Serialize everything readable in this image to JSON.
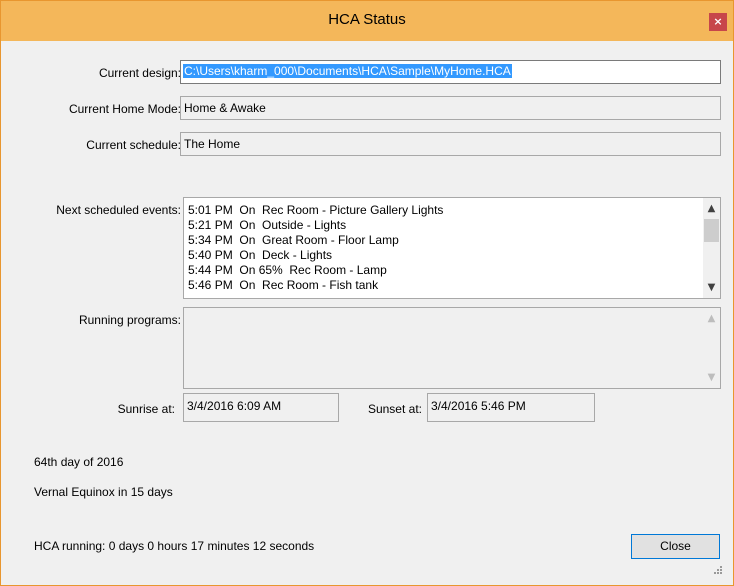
{
  "window": {
    "title": "HCA Status",
    "close_glyph": "×",
    "close_icon": "close-icon"
  },
  "fields": {
    "current_design": {
      "label": "Current design:",
      "value": "C:\\Users\\kharm_000\\Documents\\HCA\\Sample\\MyHome.HCA"
    },
    "home_mode": {
      "label": "Current Home Mode:",
      "value": "Home & Awake"
    },
    "schedule": {
      "label": "Current schedule:",
      "value": "The Home"
    }
  },
  "next_events": {
    "label": "Next scheduled events:",
    "items": [
      "5:01 PM  On  Rec Room - Picture Gallery Lights",
      "5:21 PM  On  Outside - Lights",
      "5:34 PM  On  Great Room - Floor Lamp",
      "5:40 PM  On  Deck - Lights",
      "5:44 PM  On 65%  Rec Room - Lamp",
      "5:46 PM  On  Rec Room - Fish tank"
    ],
    "scroll_up_glyph": "▲",
    "scroll_down_glyph": "▼",
    "scroll_position": 0.1,
    "scroll_thumb_fraction": 0.35
  },
  "running_programs": {
    "label": "Running programs:",
    "items": []
  },
  "sun": {
    "sunrise_label": "Sunrise at:",
    "sunrise_value": "3/4/2016 6:09 AM",
    "sunset_label": "Sunset at:",
    "sunset_value": "3/4/2016 5:46 PM"
  },
  "info": {
    "day_of_year": "64th day of 2016",
    "equinox": "Vernal Equinox in 15 days",
    "running": "HCA running: 0 days 0 hours 17 minutes 12 seconds"
  },
  "buttons": {
    "close_label": "Close"
  }
}
